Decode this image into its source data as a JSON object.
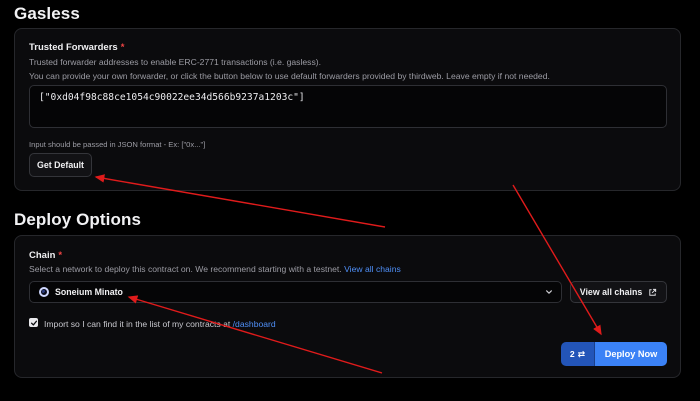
{
  "gasless": {
    "title": "Gasless",
    "trusted_forwarders": {
      "label": "Trusted Forwarders",
      "required_mark": "*",
      "description_line1": "Trusted forwarder addresses to enable ERC-2771 transactions (i.e. gasless).",
      "description_line2": "You can provide your own forwarder, or click the button below to use default forwarders provided by thirdweb. Leave empty if not needed.",
      "value": "[\"0xd04f98c88ce1054c90022ee34d566b9237a1203c\"]",
      "hint": "Input should be passed in JSON format - Ex: [\"0x...\"]",
      "get_default_label": "Get Default"
    }
  },
  "deploy_options": {
    "title": "Deploy Options",
    "chain": {
      "label": "Chain",
      "required_mark": "*",
      "description": "Select a network to deploy this contract on. We recommend starting with a testnet.",
      "view_all_link": "View all chains",
      "selected_chain": "Soneium Minato",
      "view_all_button": "View all chains"
    },
    "import_checkbox": {
      "checked": true,
      "label_text": "Import so I can find it in the list of my contracts at",
      "link_text": "/dashboard"
    },
    "deploy": {
      "count": "2",
      "label": "Deploy Now"
    }
  },
  "colors": {
    "background": "#000000",
    "card": "#0b0b0d",
    "accent_blue": "#3b82f6",
    "link_blue": "#4f8ff7",
    "required_red": "#ef4444",
    "annotation_red": "#e01b1b"
  },
  "annotations": {
    "arrow_count": 3,
    "color": "red"
  }
}
